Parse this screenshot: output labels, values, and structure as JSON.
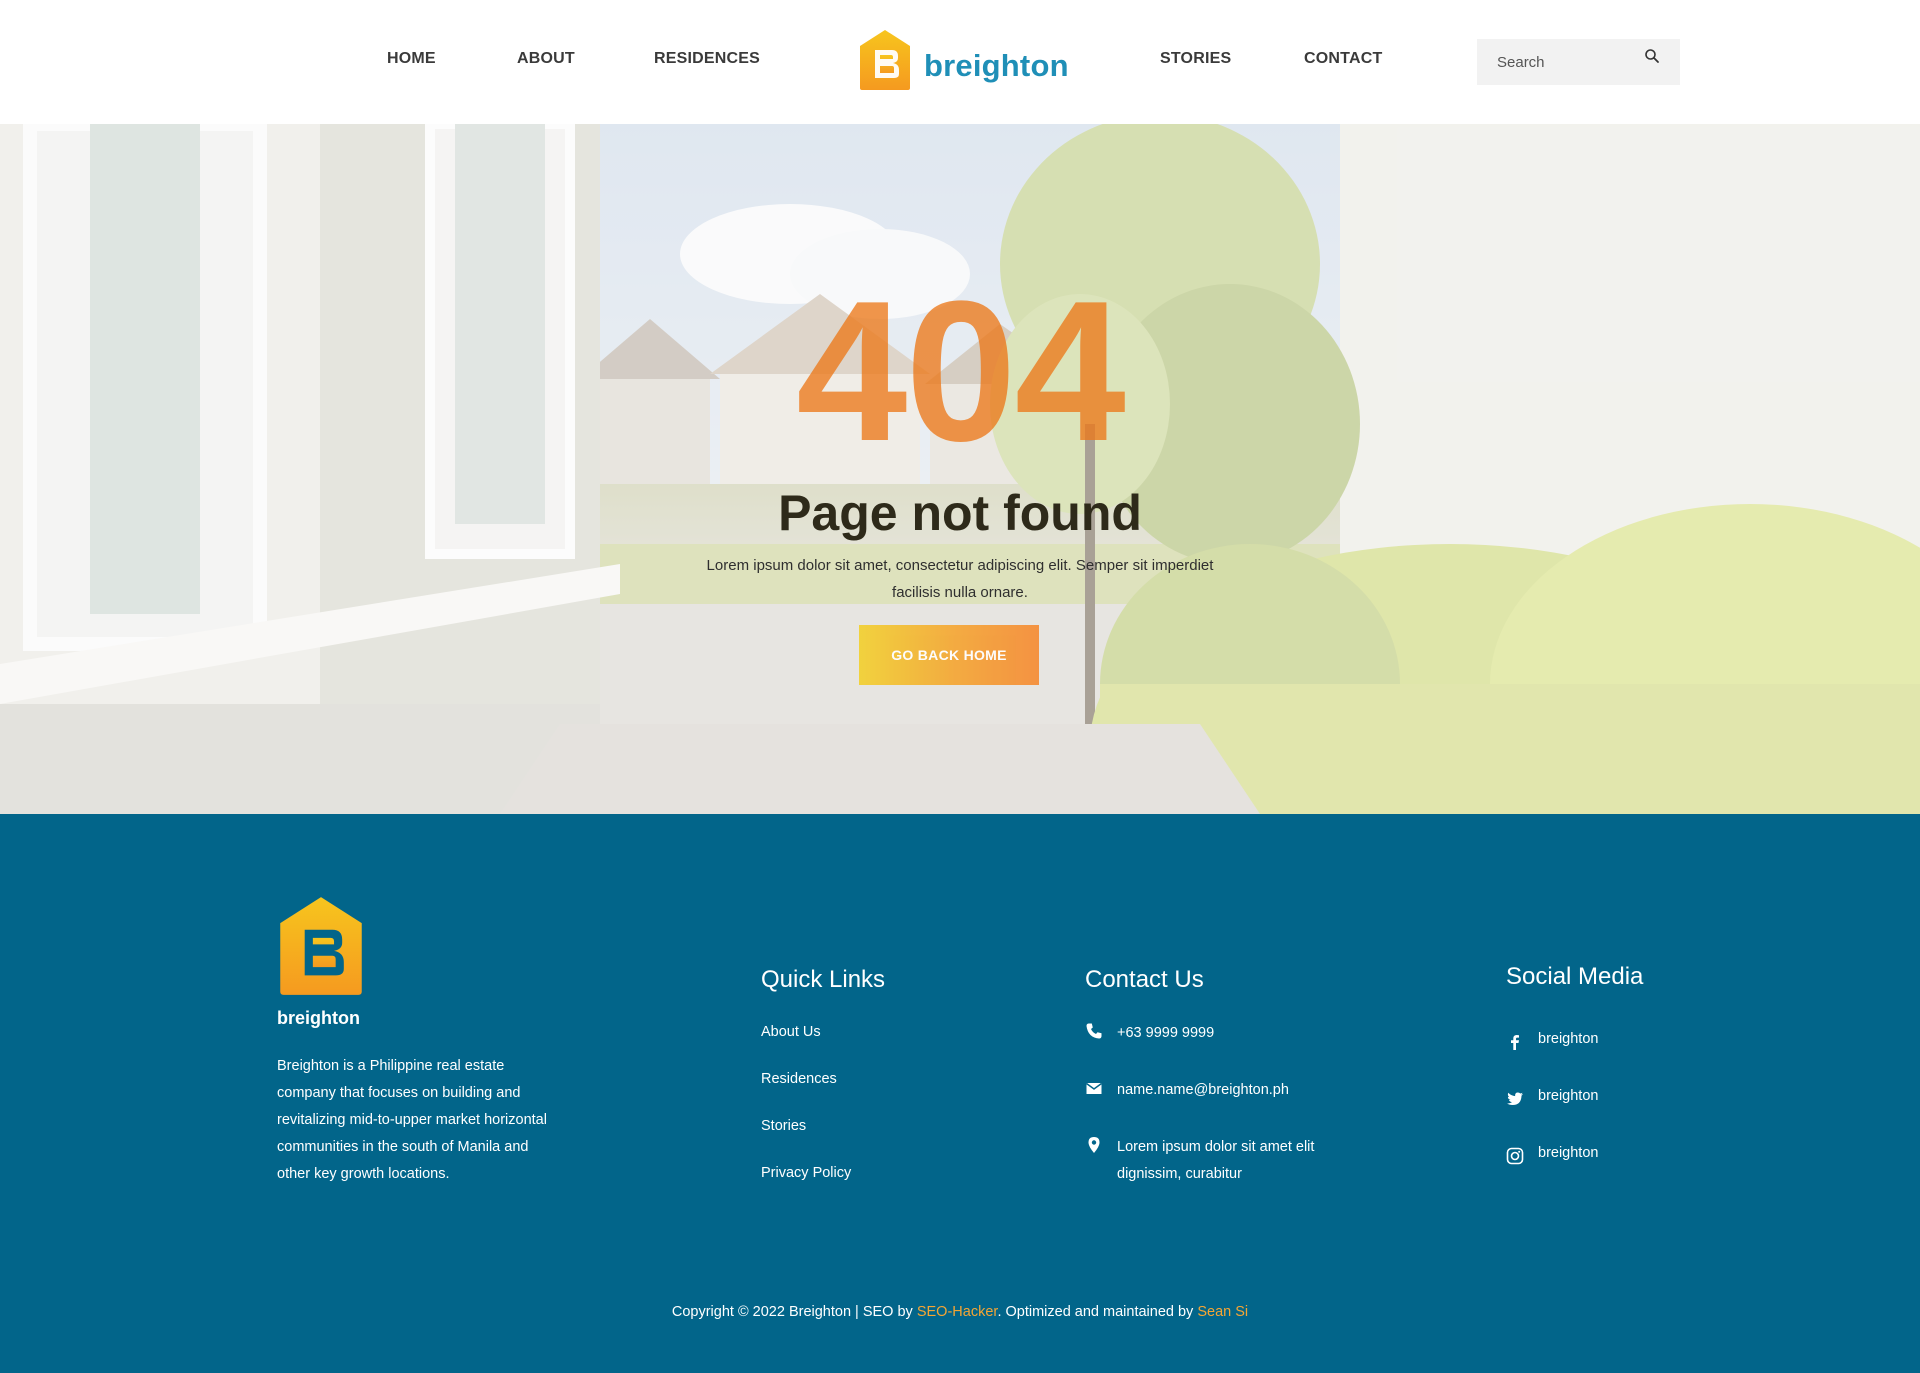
{
  "header": {
    "nav_left": [
      "HOME",
      "ABOUT",
      "RESIDENCES"
    ],
    "nav_right": [
      "STORIES",
      "CONTACT"
    ],
    "logo_text": "breighton",
    "search_placeholder": "Search",
    "search_icon": "search-icon"
  },
  "hero": {
    "code": "404",
    "title": "Page not found",
    "description": "Lorem ipsum dolor sit amet, consectetur adipiscing elit. Semper sit imperdiet facilisis nulla ornare.",
    "button_label": "GO BACK HOME"
  },
  "footer": {
    "logo_text": "breighton",
    "about": "Breighton is a Philippine real estate company that focuses on building  and revitalizing mid-to-upper  market horizontal communities in  the south of Manila and other key  growth locations.",
    "quick_links": {
      "heading": "Quick Links",
      "items": [
        "About Us",
        "Residences",
        "Stories",
        "Privacy Policy"
      ]
    },
    "contact": {
      "heading": "Contact Us",
      "phone": "+63 9999 9999",
      "email": "name.name@breighton.ph",
      "address": "Lorem ipsum dolor sit amet elit dignissim, curabitur",
      "icons": [
        "phone-icon",
        "mail-icon",
        "map-pin-icon"
      ]
    },
    "social": {
      "heading": "Social Media",
      "items": [
        {
          "icon": "facebook-icon",
          "label": "breighton"
        },
        {
          "icon": "twitter-icon",
          "label": "breighton"
        },
        {
          "icon": "instagram-icon",
          "label": "breighton"
        }
      ]
    },
    "copyright": {
      "prefix": "Copyright © 2022 Breighton | SEO by ",
      "seo_link": "SEO-Hacker",
      "middle": ". Optimized and maintained by ",
      "maintainer_link": "Sean Si"
    }
  },
  "colors": {
    "brand_blue": "#1f8fb7",
    "footer_bg": "#02658a",
    "accent_orange": "#f5a534",
    "accent_yellow": "#f2d02f",
    "error_orange": "#ec781a"
  }
}
